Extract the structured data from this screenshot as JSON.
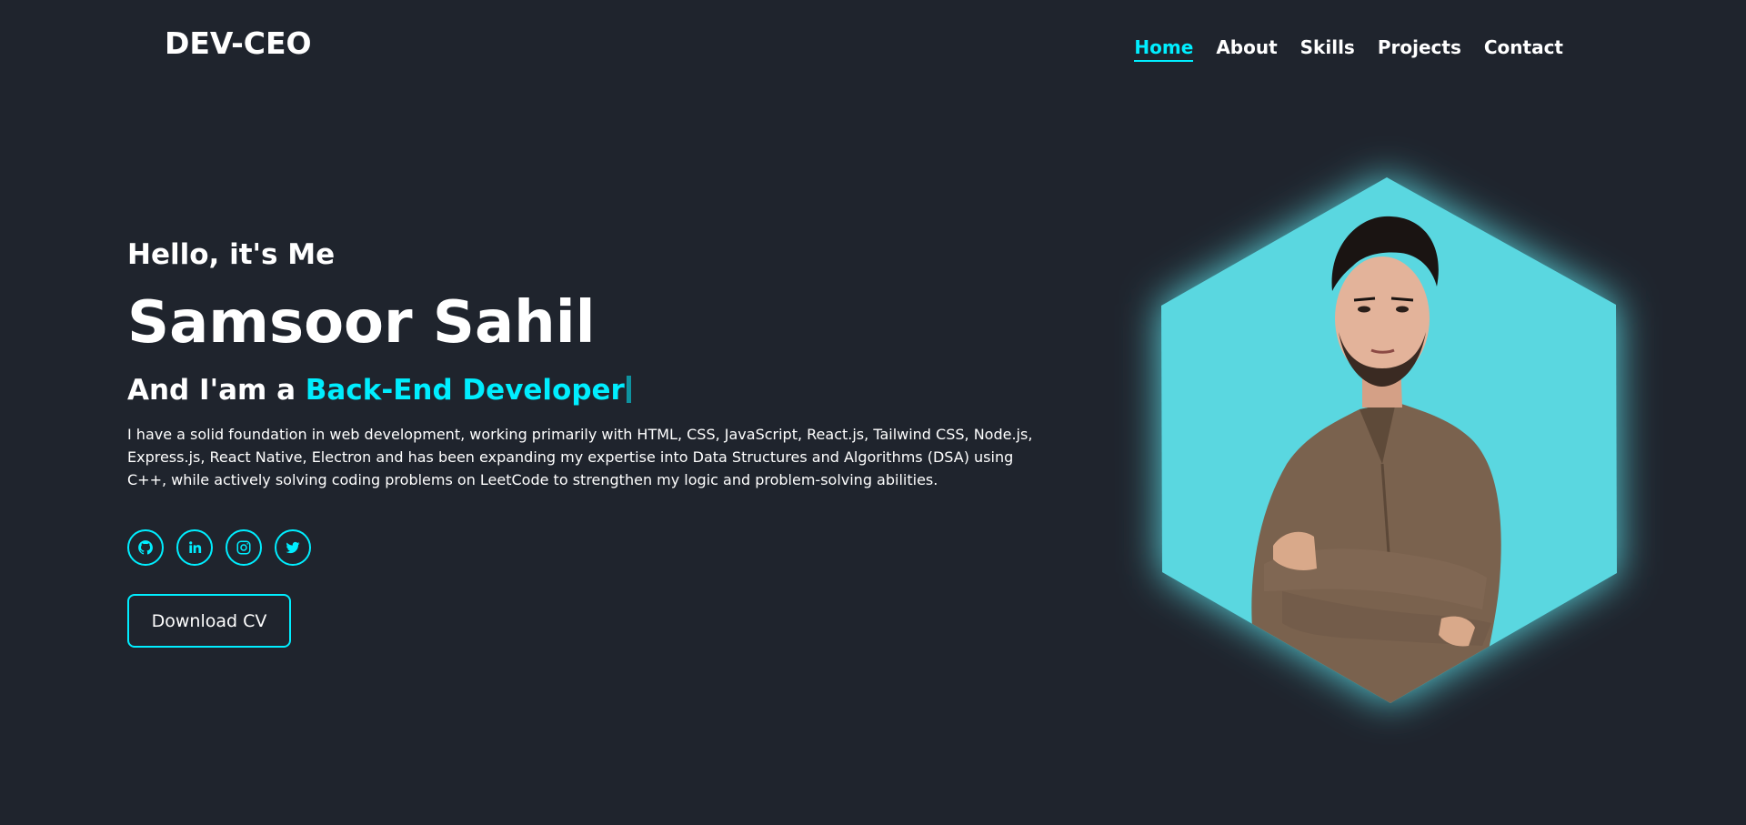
{
  "header": {
    "logo": "DEV-CEO",
    "nav": [
      {
        "label": "Home",
        "active": true
      },
      {
        "label": "About",
        "active": false
      },
      {
        "label": "Skills",
        "active": false
      },
      {
        "label": "Projects",
        "active": false
      },
      {
        "label": "Contact",
        "active": false
      }
    ]
  },
  "hero": {
    "greeting": "Hello, it's Me",
    "name": "Samsoor Sahil",
    "role_prefix": "And I'am a ",
    "role": "Back-End Developer",
    "description": "I have a solid foundation in web development, working primarily with HTML, CSS, JavaScript, React.js, Tailwind CSS, Node.js, Express.js, React Native, Electron and has been expanding my expertise into Data Structures and Algorithms (DSA) using C++, while actively solving coding problems on LeetCode to strengthen my logic and problem-solving abilities.",
    "socials": [
      {
        "icon": "github-icon"
      },
      {
        "icon": "linkedin-icon"
      },
      {
        "icon": "instagram-icon"
      },
      {
        "icon": "twitter-icon"
      }
    ],
    "cv_button": "Download CV"
  },
  "colors": {
    "background": "#1f242d",
    "accent": "#00eeff",
    "hexagon": "#5ad7e0"
  }
}
